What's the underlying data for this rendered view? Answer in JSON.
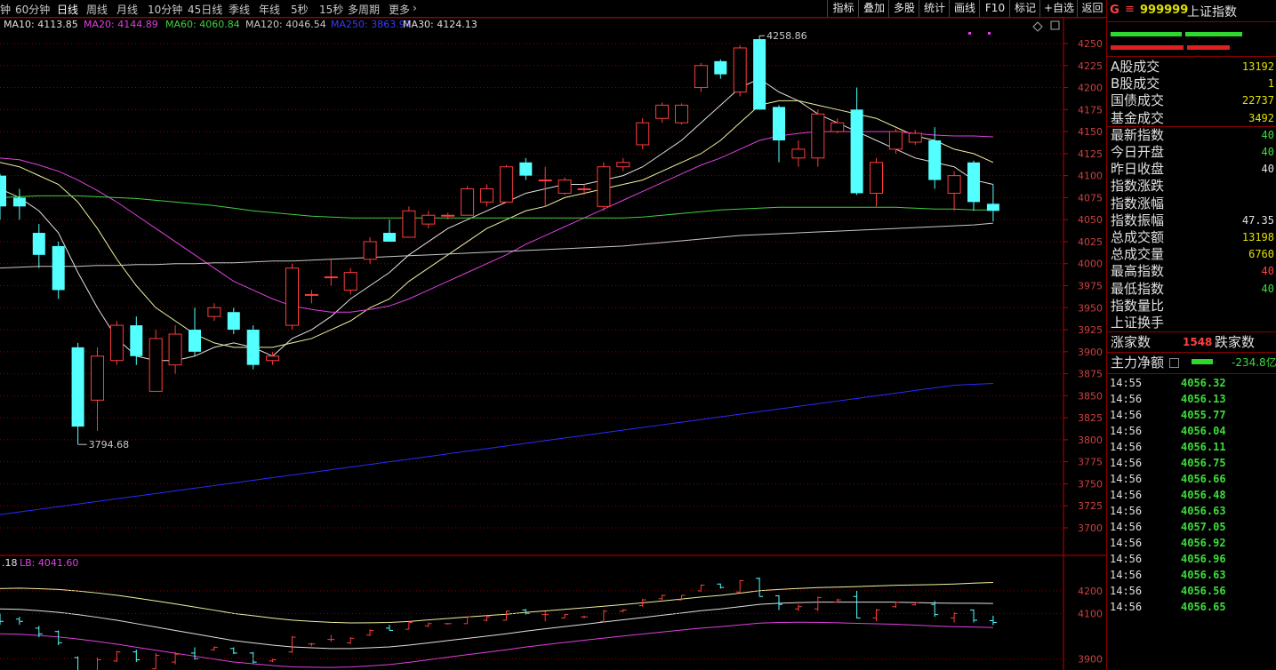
{
  "periods": [
    "钟",
    "60分钟",
    "日线",
    "周线",
    "月线",
    "10分钟",
    "45日线",
    "季线",
    "年线",
    "5秒",
    "15秒",
    "多周期",
    "更多"
  ],
  "active_period": "日线",
  "tools": [
    "指标",
    "叠加",
    "多股",
    "统计",
    "画线",
    "F10",
    "标记",
    "+自选",
    "返回"
  ],
  "ma_legend": [
    {
      "text": "MA10: 4113.85",
      "color": "#e0e0e0"
    },
    {
      "text": "MA20: 4144.89",
      "color": "#e040e0"
    },
    {
      "text": "MA60: 4060.84",
      "color": "#40d040"
    },
    {
      "text": "MA120: 4046.54",
      "color": "#c8c8c8"
    },
    {
      "text": "MA250: 3863.97",
      "color": "#3a3aff"
    },
    {
      "text": "MA30: 4124.13",
      "color": "#e0e0e0"
    }
  ],
  "price_axis": [
    "4250",
    "4225",
    "4200",
    "4175",
    "4150",
    "4125",
    "4100",
    "4075",
    "4050",
    "4025",
    "4000",
    "3975",
    "3950",
    "3925",
    "3900",
    "3875",
    "3850",
    "3825",
    "3800",
    "3775",
    "3750",
    "3725",
    "3700"
  ],
  "high_mark": "4258.86",
  "low_mark": "3794.68",
  "sub_legend": {
    "prefix": ".18",
    "lb": "LB: 4041.60"
  },
  "sub_axis": [
    "4200",
    "4100",
    "3900"
  ],
  "stock": {
    "badge": "G",
    "menu_icon": "≡",
    "code": "999999",
    "name": "上证指数"
  },
  "stats": [
    {
      "label": "A股成交",
      "value": "13192",
      "color": "#e0e000"
    },
    {
      "label": "B股成交",
      "value": "1",
      "color": "#e0e000"
    },
    {
      "label": "国债成交",
      "value": "22737",
      "color": "#e0e000"
    },
    {
      "label": "基金成交",
      "value": "3492",
      "color": "#e0e000"
    },
    {
      "label": "最新指数",
      "value": "40",
      "color": "#3cdc3c"
    },
    {
      "label": "今日开盘",
      "value": "40",
      "color": "#3cdc3c"
    },
    {
      "label": "昨日收盘",
      "value": "40",
      "color": "#e0e0e0"
    },
    {
      "label": "指数涨跌",
      "value": "",
      "color": "#3cdc3c"
    },
    {
      "label": "指数涨幅",
      "value": "",
      "color": "#3cdc3c"
    },
    {
      "label": "指数振幅",
      "value": "47.35",
      "color": "#e0e0e0"
    },
    {
      "label": "总成交额",
      "value": "13198",
      "color": "#e0e000"
    },
    {
      "label": "总成交量",
      "value": "6760",
      "color": "#e0e000"
    },
    {
      "label": "最高指数",
      "value": "40",
      "color": "#ff4040"
    },
    {
      "label": "最低指数",
      "value": "40",
      "color": "#3cdc3c"
    },
    {
      "label": "指数量比",
      "value": "",
      "color": "#e0e0e0"
    },
    {
      "label": "上证换手",
      "value": "",
      "color": "#e0e0e0"
    }
  ],
  "breadth": {
    "up_label": "涨家数",
    "up_value": "1548",
    "down_label": "跌家数"
  },
  "net_flow": {
    "label": "主力净额",
    "value": "-234.8亿"
  },
  "ticks": [
    {
      "time": "14:55",
      "price": "4056.32"
    },
    {
      "time": "14:56",
      "price": "4056.13"
    },
    {
      "time": "14:56",
      "price": "4055.77"
    },
    {
      "time": "14:56",
      "price": "4056.04"
    },
    {
      "time": "14:56",
      "price": "4056.11"
    },
    {
      "time": "14:56",
      "price": "4056.75"
    },
    {
      "time": "14:56",
      "price": "4056.66"
    },
    {
      "time": "14:56",
      "price": "4056.48"
    },
    {
      "time": "14:56",
      "price": "4056.63"
    },
    {
      "time": "14:56",
      "price": "4057.05"
    },
    {
      "time": "14:56",
      "price": "4056.92"
    },
    {
      "time": "14:56",
      "price": "4056.96"
    },
    {
      "time": "14:56",
      "price": "4056.63"
    },
    {
      "time": "14:56",
      "price": "4056.56"
    },
    {
      "time": "14:56",
      "price": "4056.65"
    }
  ],
  "chart_data": {
    "type": "candlestick",
    "price_range": [
      3700,
      4250
    ],
    "candles": [
      {
        "o": 4100,
        "c": 4065,
        "h": 4102,
        "l": 4050
      },
      {
        "o": 4075,
        "c": 4065,
        "h": 4085,
        "l": 4050
      },
      {
        "o": 4035,
        "c": 4010,
        "h": 4045,
        "l": 3995
      },
      {
        "o": 4020,
        "c": 3970,
        "h": 4025,
        "l": 3960
      },
      {
        "o": 3905,
        "c": 3815,
        "h": 3910,
        "l": 3795
      },
      {
        "o": 3845,
        "c": 3895,
        "h": 3905,
        "l": 3810
      },
      {
        "o": 3890,
        "c": 3930,
        "h": 3935,
        "l": 3885
      },
      {
        "o": 3930,
        "c": 3895,
        "h": 3940,
        "l": 3885
      },
      {
        "o": 3855,
        "c": 3915,
        "h": 3925,
        "l": 3855
      },
      {
        "o": 3885,
        "c": 3920,
        "h": 3930,
        "l": 3875
      },
      {
        "o": 3925,
        "c": 3900,
        "h": 3950,
        "l": 3895
      },
      {
        "o": 3940,
        "c": 3950,
        "h": 3955,
        "l": 3935
      },
      {
        "o": 3945,
        "c": 3925,
        "h": 3950,
        "l": 3920
      },
      {
        "o": 3925,
        "c": 3885,
        "h": 3930,
        "l": 3880
      },
      {
        "o": 3890,
        "c": 3895,
        "h": 3900,
        "l": 3885
      },
      {
        "o": 3930,
        "c": 3995,
        "h": 4000,
        "l": 3925
      },
      {
        "o": 3965,
        "c": 3965,
        "h": 3970,
        "l": 3955
      },
      {
        "o": 3985,
        "c": 3985,
        "h": 4005,
        "l": 3975
      },
      {
        "o": 3970,
        "c": 3990,
        "h": 3995,
        "l": 3965
      },
      {
        "o": 4005,
        "c": 4025,
        "h": 4030,
        "l": 4000
      },
      {
        "o": 4035,
        "c": 4025,
        "h": 4050,
        "l": 4025
      },
      {
        "o": 4030,
        "c": 4060,
        "h": 4065,
        "l": 4030
      },
      {
        "o": 4045,
        "c": 4055,
        "h": 4060,
        "l": 4040
      },
      {
        "o": 4055,
        "c": 4055,
        "h": 4058,
        "l": 4050
      },
      {
        "o": 4055,
        "c": 4085,
        "h": 4088,
        "l": 4055
      },
      {
        "o": 4070,
        "c": 4085,
        "h": 4090,
        "l": 4065
      },
      {
        "o": 4070,
        "c": 4110,
        "h": 4112,
        "l": 4070
      },
      {
        "o": 4115,
        "c": 4100,
        "h": 4120,
        "l": 4095
      },
      {
        "o": 4095,
        "c": 4095,
        "h": 4110,
        "l": 4065
      },
      {
        "o": 4080,
        "c": 4095,
        "h": 4098,
        "l": 4078
      },
      {
        "o": 4085,
        "c": 4085,
        "h": 4090,
        "l": 4078
      },
      {
        "o": 4065,
        "c": 4110,
        "h": 4115,
        "l": 4060
      },
      {
        "o": 4110,
        "c": 4115,
        "h": 4120,
        "l": 4105
      },
      {
        "o": 4135,
        "c": 4160,
        "h": 4165,
        "l": 4130
      },
      {
        "o": 4165,
        "c": 4180,
        "h": 4183,
        "l": 4160
      },
      {
        "o": 4160,
        "c": 4180,
        "h": 4182,
        "l": 4158
      },
      {
        "o": 4200,
        "c": 4225,
        "h": 4228,
        "l": 4195
      },
      {
        "o": 4230,
        "c": 4215,
        "h": 4232,
        "l": 4210
      },
      {
        "o": 4195,
        "c": 4245,
        "h": 4248,
        "l": 4190
      },
      {
        "o": 4255,
        "c": 4175,
        "h": 4259,
        "l": 4175
      },
      {
        "o": 4178,
        "c": 4140,
        "h": 4180,
        "l": 4115
      },
      {
        "o": 4120,
        "c": 4130,
        "h": 4140,
        "l": 4110
      },
      {
        "o": 4120,
        "c": 4170,
        "h": 4175,
        "l": 4110
      },
      {
        "o": 4150,
        "c": 4160,
        "h": 4165,
        "l": 4148
      },
      {
        "o": 4175,
        "c": 4080,
        "h": 4200,
        "l": 4078
      },
      {
        "o": 4080,
        "c": 4115,
        "h": 4120,
        "l": 4065
      },
      {
        "o": 4130,
        "c": 4150,
        "h": 4153,
        "l": 4125
      },
      {
        "o": 4138,
        "c": 4148,
        "h": 4152,
        "l": 4135
      },
      {
        "o": 4140,
        "c": 4095,
        "h": 4155,
        "l": 4085
      },
      {
        "o": 4080,
        "c": 4100,
        "h": 4105,
        "l": 4060
      },
      {
        "o": 4115,
        "c": 4070,
        "h": 4117,
        "l": 4060
      },
      {
        "o": 4068,
        "c": 4060,
        "h": 4090,
        "l": 4048
      }
    ],
    "ma_series": {
      "MA5": [
        4085,
        4075,
        4060,
        4035,
        3990,
        3950,
        3915,
        3895,
        3890,
        3890,
        3895,
        3905,
        3910,
        3905,
        3895,
        3915,
        3925,
        3940,
        3960,
        3975,
        3990,
        4010,
        4025,
        4040,
        4050,
        4060,
        4070,
        4080,
        4085,
        4090,
        4090,
        4095,
        4100,
        4110,
        4125,
        4140,
        4160,
        4180,
        4200,
        4210,
        4195,
        4185,
        4170,
        4160,
        4150,
        4140,
        4130,
        4120,
        4115,
        4110,
        4095,
        4090
      ],
      "MA10": [
        4115,
        4110,
        4100,
        4090,
        4070,
        4040,
        4005,
        3975,
        3950,
        3935,
        3920,
        3910,
        3905,
        3905,
        3905,
        3910,
        3915,
        3925,
        3935,
        3950,
        3960,
        3980,
        3995,
        4010,
        4025,
        4040,
        4050,
        4060,
        4065,
        4075,
        4080,
        4085,
        4090,
        4095,
        4105,
        4115,
        4125,
        4140,
        4160,
        4180,
        4185,
        4185,
        4180,
        4175,
        4170,
        4165,
        4155,
        4145,
        4140,
        4130,
        4125,
        4115
      ],
      "MA20": [
        4120,
        4118,
        4112,
        4105,
        4095,
        4083,
        4070,
        4055,
        4040,
        4025,
        4010,
        3995,
        3980,
        3970,
        3960,
        3952,
        3948,
        3945,
        3945,
        3948,
        3952,
        3960,
        3970,
        3980,
        3990,
        4000,
        4010,
        4022,
        4032,
        4042,
        4052,
        4062,
        4072,
        4082,
        4092,
        4102,
        4112,
        4120,
        4130,
        4140,
        4145,
        4148,
        4150,
        4150,
        4150,
        4150,
        4150,
        4148,
        4146,
        4145,
        4145,
        4144
      ],
      "MA60": [
        4075,
        4076,
        4077,
        4077,
        4077,
        4076,
        4075,
        4074,
        4072,
        4070,
        4068,
        4066,
        4063,
        4060,
        4058,
        4056,
        4054,
        4053,
        4052,
        4052,
        4052,
        4052,
        4052,
        4052,
        4052,
        4052,
        4052,
        4052,
        4052,
        4052,
        4052,
        4052,
        4052,
        4053,
        4055,
        4057,
        4059,
        4061,
        4062,
        4063,
        4064,
        4064,
        4064,
        4064,
        4064,
        4064,
        4064,
        4063,
        4062,
        4062,
        4061,
        4061
      ],
      "MA120": [
        3995,
        3996,
        3997,
        3997,
        3997,
        3998,
        3998,
        3999,
        3999,
        4000,
        4000,
        4001,
        4001,
        4002,
        4003,
        4003,
        4004,
        4005,
        4006,
        4007,
        4008,
        4009,
        4010,
        4011,
        4012,
        4013,
        4014,
        4015,
        4016,
        4017,
        4018,
        4019,
        4020,
        4022,
        4024,
        4026,
        4028,
        4030,
        4032,
        4033,
        4034,
        4035,
        4036,
        4037,
        4038,
        4039,
        4040,
        4041,
        4042,
        4043,
        4044,
        4046
      ],
      "MA250": [
        3715,
        3718,
        3721,
        3724,
        3727,
        3730,
        3733,
        3736,
        3739,
        3742,
        3745,
        3748,
        3751,
        3754,
        3757,
        3760,
        3763,
        3766,
        3769,
        3772,
        3775,
        3778,
        3781,
        3784,
        3787,
        3790,
        3793,
        3796,
        3799,
        3802,
        3805,
        3808,
        3811,
        3814,
        3817,
        3820,
        3823,
        3826,
        3829,
        3832,
        3835,
        3838,
        3841,
        3844,
        3847,
        3850,
        3853,
        3856,
        3859,
        3862,
        3863,
        3864
      ]
    },
    "sub_range": [
      3850,
      4290
    ]
  }
}
